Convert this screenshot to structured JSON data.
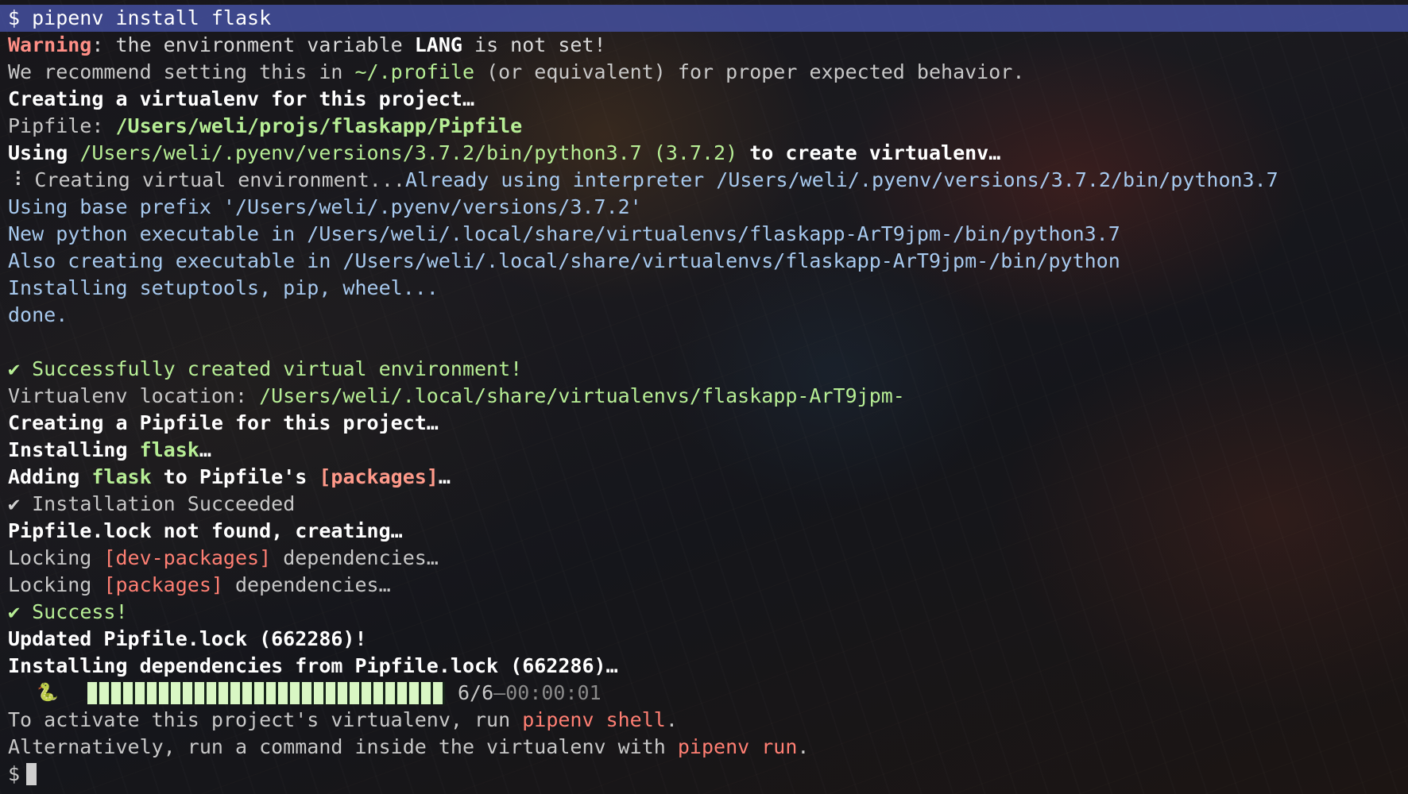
{
  "terminal": {
    "command_line": "$ pipenv install flask",
    "warning": {
      "label": "Warning",
      "text_before": ": the environment variable ",
      "var": "LANG",
      "text_after": " is not set!"
    },
    "recommend": {
      "before": "We recommend setting this in ",
      "path": "~/.profile",
      "after": " (or equivalent) for proper expected behavior."
    },
    "creating_venv": "Creating a virtualenv for this project…",
    "pipfile": {
      "label": "Pipfile: ",
      "path": "/Users/weli/projs/flaskapp/Pipfile"
    },
    "using": {
      "label": "Using ",
      "path": "/Users/weli/.pyenv/versions/3.7.2/bin/python3.7",
      "version": " (3.7.2)",
      "after": " to create virtualenv…"
    },
    "creating_env": {
      "spinner": "⠸",
      "text": " Creating virtual environment...",
      "already": "Already using interpreter /Users/weli/.pyenv/versions/3.7.2/bin/python3.7"
    },
    "base_prefix": "Using base prefix '/Users/weli/.pyenv/versions/3.7.2'",
    "new_python": "New python executable in /Users/weli/.local/share/virtualenvs/flaskapp-ArT9jpm-/bin/python3.7",
    "also_creating": "Also creating executable in /Users/weli/.local/share/virtualenvs/flaskapp-ArT9jpm-/bin/python",
    "installing_setuptools": "Installing setuptools, pip, wheel...",
    "done": "done.",
    "success_created": {
      "check": "✔",
      "text": " Successfully created virtual environment!"
    },
    "venv_location": {
      "label": "Virtualenv location: ",
      "path": "/Users/weli/.local/share/virtualenvs/flaskapp-ArT9jpm-"
    },
    "creating_pipfile": "Creating a Pipfile for this project…",
    "installing_flask": {
      "label": "Installing ",
      "pkg": "flask",
      "after": "…"
    },
    "adding_flask": {
      "label": "Adding ",
      "pkg": "flask",
      "middle": " to Pipfile's ",
      "section": "[packages]",
      "after": "…"
    },
    "install_succeeded": {
      "check": "✔",
      "text": " Installation Succeeded"
    },
    "lock_not_found": "Pipfile.lock not found, creating…",
    "locking_dev": {
      "label": "Locking ",
      "section": "[dev-packages]",
      "after": " dependencies…"
    },
    "locking_packages": {
      "label": "Locking ",
      "section": "[packages]",
      "after": " dependencies…"
    },
    "success": {
      "check": "✔",
      "text": " Success!"
    },
    "updated_lock": "Updated Pipfile.lock (662286)!",
    "installing_deps": "Installing dependencies from Pipfile.lock (662286)…",
    "progress": {
      "icon": "snake-icon",
      "fraction": 1.0,
      "count": "6/6",
      "separator": " – ",
      "elapsed": "00:00:01"
    },
    "activate": {
      "before": "To activate this project's virtualenv, run ",
      "cmd": "pipenv shell",
      "after": "."
    },
    "alternatively": {
      "before": "Alternatively, run a command inside the virtualenv with ",
      "cmd": "pipenv run",
      "after": "."
    },
    "prompt": "$"
  },
  "colors": {
    "highlight_bar": "#4854aa",
    "warning": "#ff8f86",
    "path_green": "#b7ee95",
    "info_blue": "#a7c9ee",
    "accent_red": "#ff7f73"
  }
}
